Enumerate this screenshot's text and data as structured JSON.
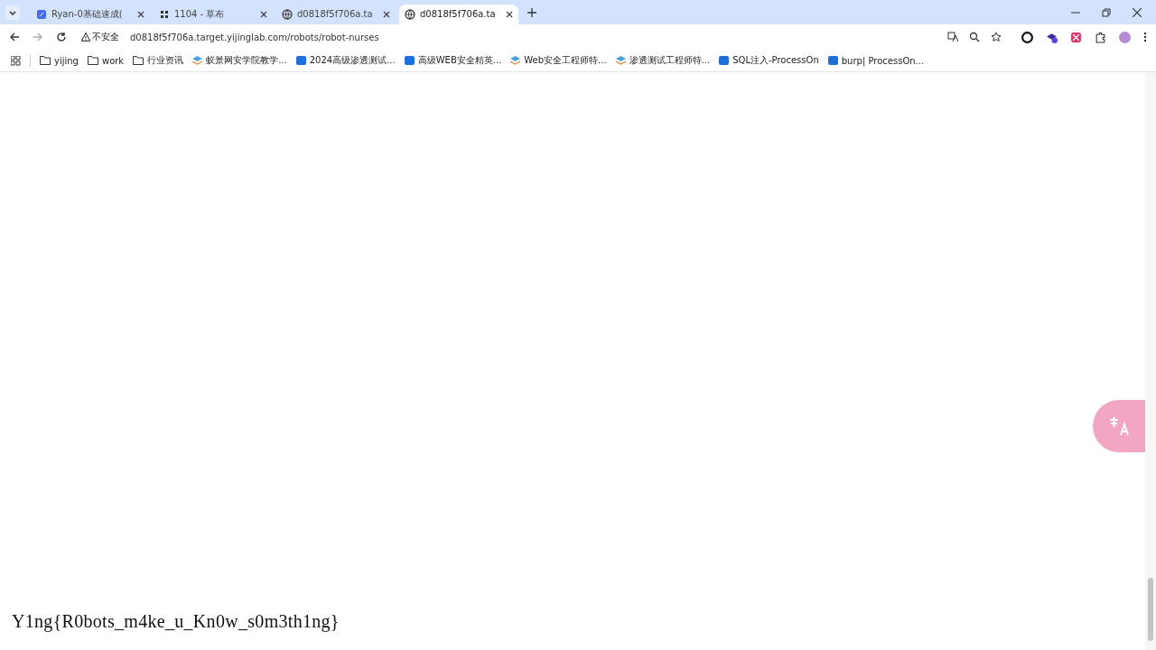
{
  "tabs": [
    {
      "title": "Ryan-0基础速成(",
      "selected": false
    },
    {
      "title": "1104 - 草布",
      "selected": false
    },
    {
      "title": "d0818f5f706a.ta",
      "selected": false
    },
    {
      "title": "d0818f5f706a.ta",
      "selected": true
    }
  ],
  "address_bar": {
    "security": "不安全",
    "url": "d0818f5f706a.target.yijinglab.com/robots/robot-nurses"
  },
  "bookmarks": [
    {
      "label": "yijing",
      "kind": "folder"
    },
    {
      "label": "work",
      "kind": "folder"
    },
    {
      "label": "行业资讯",
      "kind": "folder"
    },
    {
      "label": "蚁景网安学院教学...",
      "kind": "site"
    },
    {
      "label": "2024高级渗透测试...",
      "kind": "on"
    },
    {
      "label": "高级WEB安全精英...",
      "kind": "on"
    },
    {
      "label": "Web安全工程师特...",
      "kind": "site"
    },
    {
      "label": "渗透测试工程师特...",
      "kind": "site"
    },
    {
      "label": "SQL注入-ProcessOn",
      "kind": "on"
    },
    {
      "label": "burp| ProcessOn...",
      "kind": "on"
    }
  ],
  "page": {
    "text": "Y1ng{R0bots_m4ke_u_Kn0w_s0m3th1ng}"
  }
}
